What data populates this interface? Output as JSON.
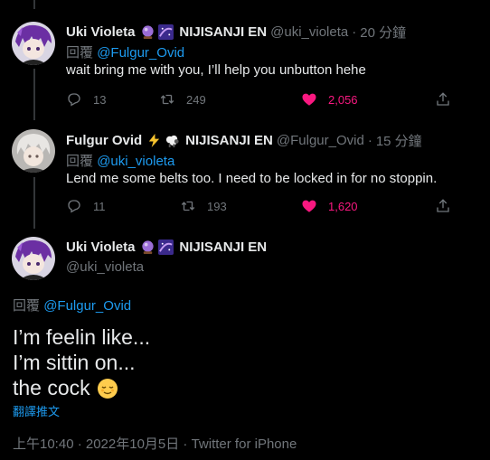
{
  "tweets": [
    {
      "display_name": "Uki Violeta",
      "org": "NIJISANJI EN",
      "handle": "@uki_violeta",
      "time": "20 分鐘",
      "reply_prefix": "回覆",
      "reply_to": "@Fulgur_Ovid",
      "text": "wait bring me with you, I’ll help you unbutton hehe",
      "replies": "13",
      "retweets": "249",
      "likes": "2,056"
    },
    {
      "display_name": "Fulgur Ovid",
      "org": "NIJISANJI EN",
      "handle": "@Fulgur_Ovid",
      "time": "15 分鐘",
      "reply_prefix": "回覆",
      "reply_to": "@uki_violeta",
      "text": "Lend me some belts too. I need to be locked in for no stoppin.",
      "replies": "11",
      "retweets": "193",
      "likes": "1,620"
    }
  ],
  "main_tweet": {
    "display_name": "Uki Violeta",
    "org": "NIJISANJI EN",
    "handle": "@uki_violeta",
    "reply_prefix": "回覆",
    "reply_to": "@Fulgur_Ovid",
    "lines": [
      "I’m feelin like...",
      "I’m sittin on...",
      "the cock"
    ],
    "translate_label": "翻譯推文",
    "timestamp": "上午10:40 · 2022年10月5日 · Twitter for iPhone"
  },
  "separator": "·",
  "icons": {
    "reply": "reply-icon",
    "retweet": "retweet-icon",
    "like": "heart-icon",
    "share": "share-icon",
    "crystal_ball": "crystal-ball-emoji",
    "galaxy": "galaxy-emoji",
    "lightning": "lightning-emoji",
    "sheep": "sheep-emoji",
    "relieved": "relieved-face-emoji"
  },
  "colors": {
    "background": "#000000",
    "text": "#e7e9ea",
    "muted": "#71767b",
    "link": "#1d9bf0",
    "like": "#f91880"
  }
}
